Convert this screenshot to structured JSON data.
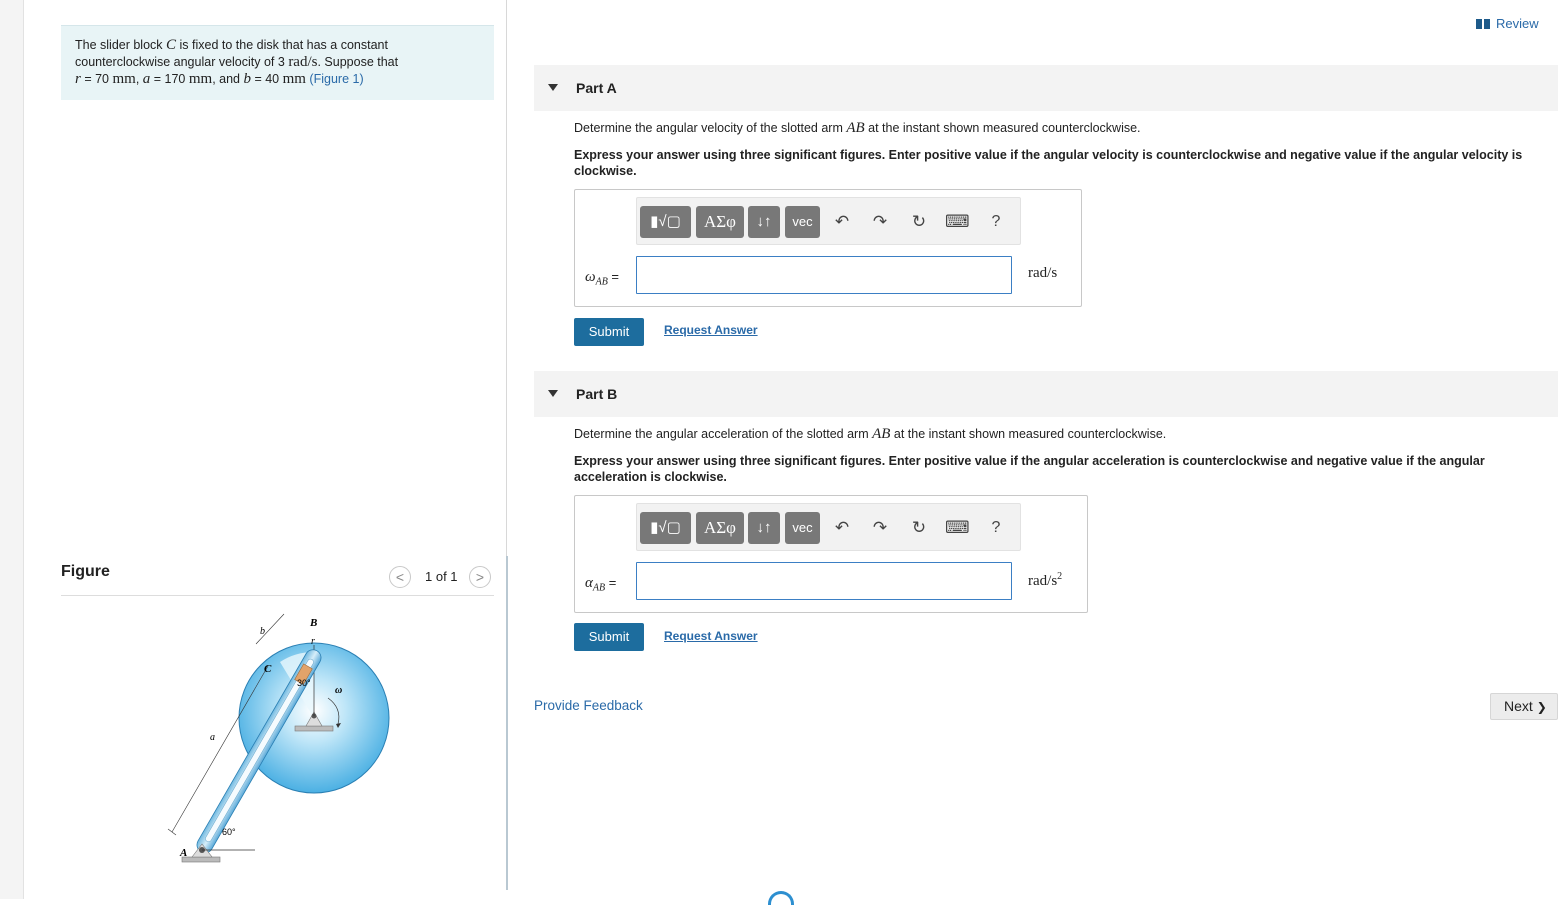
{
  "problem": {
    "line1_pre": "The slider block ",
    "slider_var": "C",
    "line1_post": " is fixed to the disk that has a constant",
    "line2_pre": "counterclockwise angular velocity of 3 ",
    "omega_unit": "rad/s",
    "line2_post": ". Suppose that",
    "r_var": "r",
    "r_val": " = 70 ",
    "r_unit": "mm",
    "sep1": ", ",
    "a_var": "a",
    "a_val": " = 170 ",
    "a_unit": "mm",
    "sep2": ", and ",
    "b_var": "b",
    "b_val": " = 40 ",
    "b_unit": "mm",
    "figure_link": "(Figure 1)"
  },
  "figure_panel": {
    "title": "Figure",
    "pager_prev": "<",
    "pager_text": "1 of 1",
    "pager_next": ">",
    "labels": {
      "A": "A",
      "B": "B",
      "C": "C",
      "a": "a",
      "b": "b",
      "r": "r",
      "omega": "ω",
      "angle30": "30°",
      "angle60": "60°"
    }
  },
  "header": {
    "review_label": "Review"
  },
  "partA": {
    "title": "Part A",
    "question_pre": "Determine the angular velocity of the slotted arm ",
    "question_var": "AB",
    "question_post": " at the instant shown measured counterclockwise.",
    "instruction": "Express your answer using three significant figures. Enter positive value if the angular velocity is counterclockwise and negative value if the angular velocity is clockwise.",
    "var_symbol": "ω",
    "var_sub": "AB",
    "var_eq": " =",
    "unit": "rad/s",
    "input_value": "",
    "submit_label": "Submit",
    "request_label": "Request Answer"
  },
  "partB": {
    "title": "Part B",
    "question_pre": "Determine the angular acceleration of the slotted arm ",
    "question_var": "AB",
    "question_post": " at the instant shown measured counterclockwise.",
    "instruction": "Express your answer using three significant figures. Enter positive value if the angular acceleration is counterclockwise and negative value if the angular acceleration is clockwise.",
    "var_symbol": "α",
    "var_sub": "AB",
    "var_eq": " =",
    "unit_base": "rad/s",
    "unit_exp": "2",
    "input_value": "",
    "submit_label": "Submit",
    "request_label": "Request Answer"
  },
  "toolbar": {
    "templates": "▮√▢",
    "symbols": "ΑΣφ",
    "arrows": "↓↑",
    "vec": "vec",
    "undo_icon": "undo-icon",
    "redo_icon": "redo-icon",
    "reset_icon": "reset-icon",
    "keyboard_icon": "keyboard-icon",
    "help": "?"
  },
  "footer": {
    "feedback_label": "Provide Feedback",
    "next_label": "Next",
    "next_chevron": "❯"
  },
  "colors": {
    "link": "#2a6aa8",
    "submit": "#1d6d9e",
    "problem_bg": "#e8f4f6",
    "disk": "#5bbfe9"
  }
}
